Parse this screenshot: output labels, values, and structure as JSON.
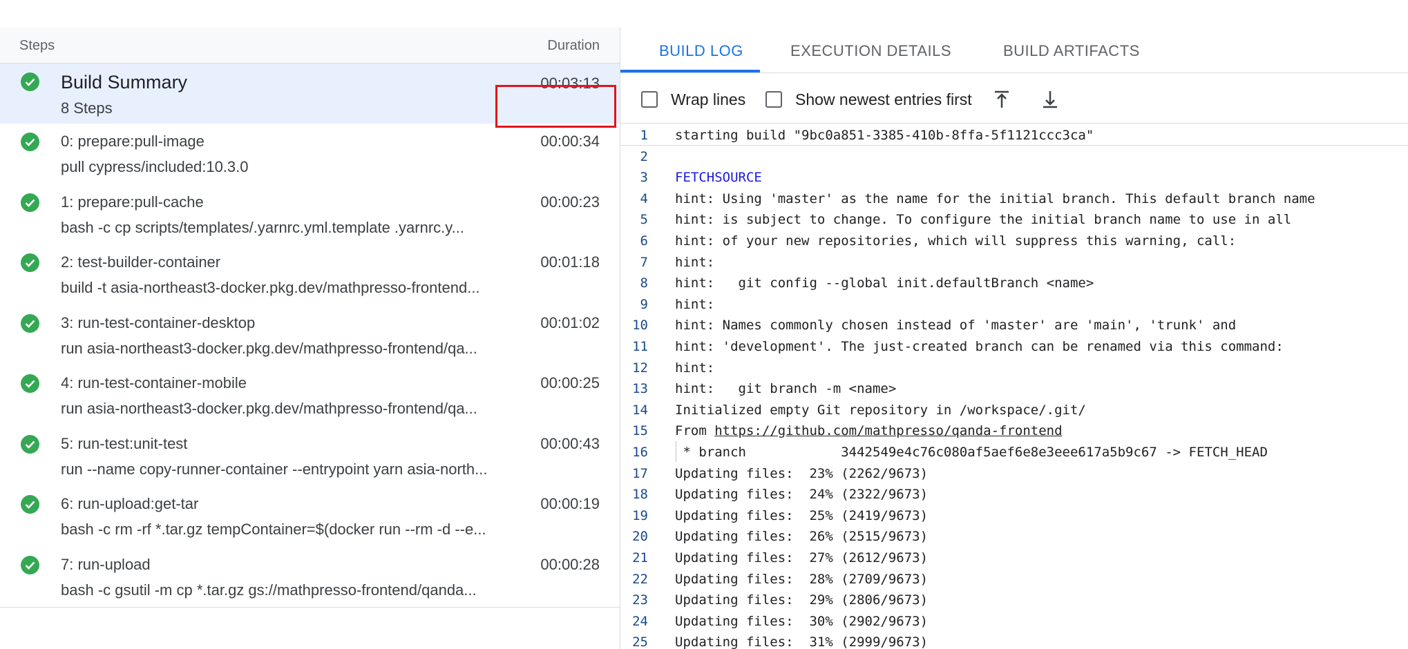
{
  "steps_panel": {
    "header": {
      "steps_label": "Steps",
      "duration_label": "Duration"
    },
    "steps": [
      {
        "name": "Build Summary",
        "desc": "8 Steps",
        "duration": "00:03:13",
        "status": "success",
        "selected": true
      },
      {
        "name": "0: prepare:pull-image",
        "desc": "pull cypress/included:10.3.0",
        "duration": "00:00:34",
        "status": "success"
      },
      {
        "name": "1: prepare:pull-cache",
        "desc": "bash -c cp scripts/templates/.yarnrc.yml.template .yarnrc.y...",
        "duration": "00:00:23",
        "status": "success"
      },
      {
        "name": "2: test-builder-container",
        "desc": "build -t asia-northeast3-docker.pkg.dev/mathpresso-frontend...",
        "duration": "00:01:18",
        "status": "success"
      },
      {
        "name": "3: run-test-container-desktop",
        "desc": "run asia-northeast3-docker.pkg.dev/mathpresso-frontend/qa...",
        "duration": "00:01:02",
        "status": "success"
      },
      {
        "name": "4: run-test-container-mobile",
        "desc": "run asia-northeast3-docker.pkg.dev/mathpresso-frontend/qa...",
        "duration": "00:00:25",
        "status": "success"
      },
      {
        "name": "5: run-test:unit-test",
        "desc": "run --name copy-runner-container --entrypoint yarn asia-north...",
        "duration": "00:00:43",
        "status": "success"
      },
      {
        "name": "6: run-upload:get-tar",
        "desc": "bash -c rm -rf *.tar.gz tempContainer=$(docker run --rm -d --e...",
        "duration": "00:00:19",
        "status": "success"
      },
      {
        "name": "7: run-upload",
        "desc": "bash -c gsutil -m cp *.tar.gz gs://mathpresso-frontend/qanda...",
        "duration": "00:00:28",
        "status": "success"
      }
    ]
  },
  "tabs": [
    {
      "label": "BUILD LOG",
      "active": true
    },
    {
      "label": "EXECUTION DETAILS",
      "active": false
    },
    {
      "label": "BUILD ARTIFACTS",
      "active": false
    }
  ],
  "toolbar": {
    "wrap_lines_label": "Wrap lines",
    "wrap_lines_checked": false,
    "newest_first_label": "Show newest entries first",
    "newest_first_checked": false,
    "scroll_top_icon": "scroll-to-top-icon",
    "scroll_bottom_icon": "scroll-to-bottom-icon"
  },
  "log": {
    "lines": [
      {
        "n": "1",
        "text": "starting build \"9bc0a851-3385-410b-8ffa-5f1121ccc3ca\""
      },
      {
        "n": "2",
        "text": ""
      },
      {
        "n": "3",
        "text": "FETCHSOURCE",
        "section": true
      },
      {
        "n": "4",
        "text": "hint: Using 'master' as the name for the initial branch. This default branch name"
      },
      {
        "n": "5",
        "text": "hint: is subject to change. To configure the initial branch name to use in all"
      },
      {
        "n": "6",
        "text": "hint: of your new repositories, which will suppress this warning, call:"
      },
      {
        "n": "7",
        "text": "hint:"
      },
      {
        "n": "8",
        "text": "hint:   git config --global init.defaultBranch <name>"
      },
      {
        "n": "9",
        "text": "hint:"
      },
      {
        "n": "10",
        "text": "hint: Names commonly chosen instead of 'master' are 'main', 'trunk' and"
      },
      {
        "n": "11",
        "text": "hint: 'development'. The just-created branch can be renamed via this command:"
      },
      {
        "n": "12",
        "text": "hint:"
      },
      {
        "n": "13",
        "text": "hint:   git branch -m <name>"
      },
      {
        "n": "14",
        "text": "Initialized empty Git repository in /workspace/.git/"
      },
      {
        "n": "15",
        "text": "From ",
        "link": "https://github.com/mathpresso/qanda-frontend"
      },
      {
        "n": "16",
        "text": " * branch            3442549e4c76c080af5aef6e8e3eee617a5b9c67 -> FETCH_HEAD",
        "indent": true
      },
      {
        "n": "17",
        "text": "Updating files:  23% (2262/9673)"
      },
      {
        "n": "18",
        "text": "Updating files:  24% (2322/9673)"
      },
      {
        "n": "19",
        "text": "Updating files:  25% (2419/9673)"
      },
      {
        "n": "20",
        "text": "Updating files:  26% (2515/9673)"
      },
      {
        "n": "21",
        "text": "Updating files:  27% (2612/9673)"
      },
      {
        "n": "22",
        "text": "Updating files:  28% (2709/9673)"
      },
      {
        "n": "23",
        "text": "Updating files:  29% (2806/9673)"
      },
      {
        "n": "24",
        "text": "Updating files:  30% (2902/9673)"
      },
      {
        "n": "25",
        "text": "Updating files:  31% (2999/9673)"
      }
    ]
  },
  "colors": {
    "accent": "#1a73e8",
    "success": "#34a853",
    "selected_row": "#e8f0fe",
    "highlight_box": "#e0151a"
  }
}
